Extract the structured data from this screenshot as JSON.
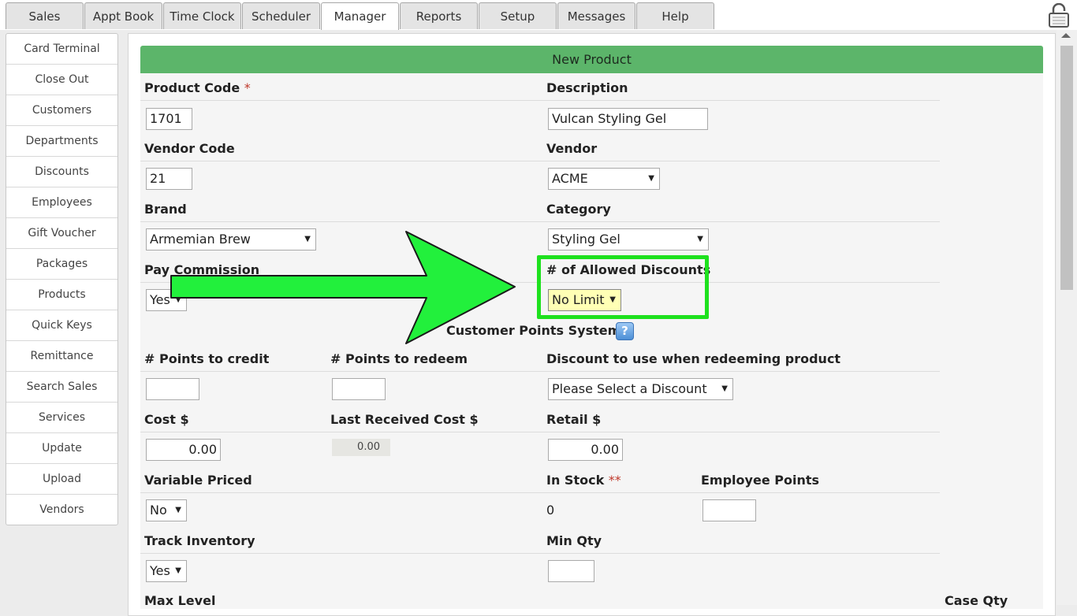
{
  "tabs": [
    {
      "label": "Sales"
    },
    {
      "label": "Appt Book"
    },
    {
      "label": "Time Clock"
    },
    {
      "label": "Scheduler"
    },
    {
      "label": "Manager"
    },
    {
      "label": "Reports"
    },
    {
      "label": "Setup"
    },
    {
      "label": "Messages"
    },
    {
      "label": "Help"
    }
  ],
  "active_tab": "Manager",
  "sidebar": {
    "items": [
      {
        "label": "Card Terminal"
      },
      {
        "label": "Close Out"
      },
      {
        "label": "Customers"
      },
      {
        "label": "Departments"
      },
      {
        "label": "Discounts"
      },
      {
        "label": "Employees"
      },
      {
        "label": "Gift Voucher"
      },
      {
        "label": "Packages"
      },
      {
        "label": "Products"
      },
      {
        "label": "Quick Keys"
      },
      {
        "label": "Remittance"
      },
      {
        "label": "Search Sales"
      },
      {
        "label": "Services"
      },
      {
        "label": "Update"
      },
      {
        "label": "Upload"
      },
      {
        "label": "Vendors"
      }
    ]
  },
  "panel": {
    "title": "New Product"
  },
  "form": {
    "product_code": {
      "label": "Product Code",
      "required_mark": "*",
      "value": "1701"
    },
    "description": {
      "label": "Description",
      "value": "Vulcan Styling Gel"
    },
    "vendor_code": {
      "label": "Vendor Code",
      "value": "21"
    },
    "vendor": {
      "label": "Vendor",
      "value": "ACME"
    },
    "brand": {
      "label": "Brand",
      "value": "Armemian Brew"
    },
    "category": {
      "label": "Category",
      "value": "Styling Gel"
    },
    "pay_commission": {
      "label": "Pay Commission",
      "value": "Yes"
    },
    "allowed_discounts": {
      "label": "# of Allowed Discounts",
      "value": "No Limit"
    },
    "customer_points": {
      "label": "Customer Points System",
      "help": "?"
    },
    "points_credit": {
      "label": "# Points to credit",
      "value": ""
    },
    "points_redeem": {
      "label": "# Points to redeem",
      "value": ""
    },
    "redeem_discount": {
      "label": "Discount to use when redeeming product",
      "value": "Please Select a Discount"
    },
    "cost": {
      "label": "Cost $",
      "value": "0.00"
    },
    "last_received_cost": {
      "label": "Last Received Cost $",
      "value": "0.00"
    },
    "retail": {
      "label": "Retail $",
      "value": "0.00"
    },
    "variable_priced": {
      "label": "Variable Priced",
      "value": "No"
    },
    "in_stock": {
      "label": "In Stock",
      "required_mark": "**",
      "value": "0"
    },
    "employee_points": {
      "label": "Employee Points",
      "value": ""
    },
    "track_inventory": {
      "label": "Track Inventory",
      "value": "Yes"
    },
    "min_qty": {
      "label": "Min Qty",
      "value": ""
    },
    "max_level": {
      "label": "Max Level"
    },
    "case_qty": {
      "label": "Case Qty"
    }
  },
  "dropdown_arrow": "▼",
  "colors": {
    "header_green": "#5cb56a",
    "highlight_green": "#1ee11e",
    "arrow_green": "#22f03c",
    "select_highlight": "#ffffb5"
  }
}
